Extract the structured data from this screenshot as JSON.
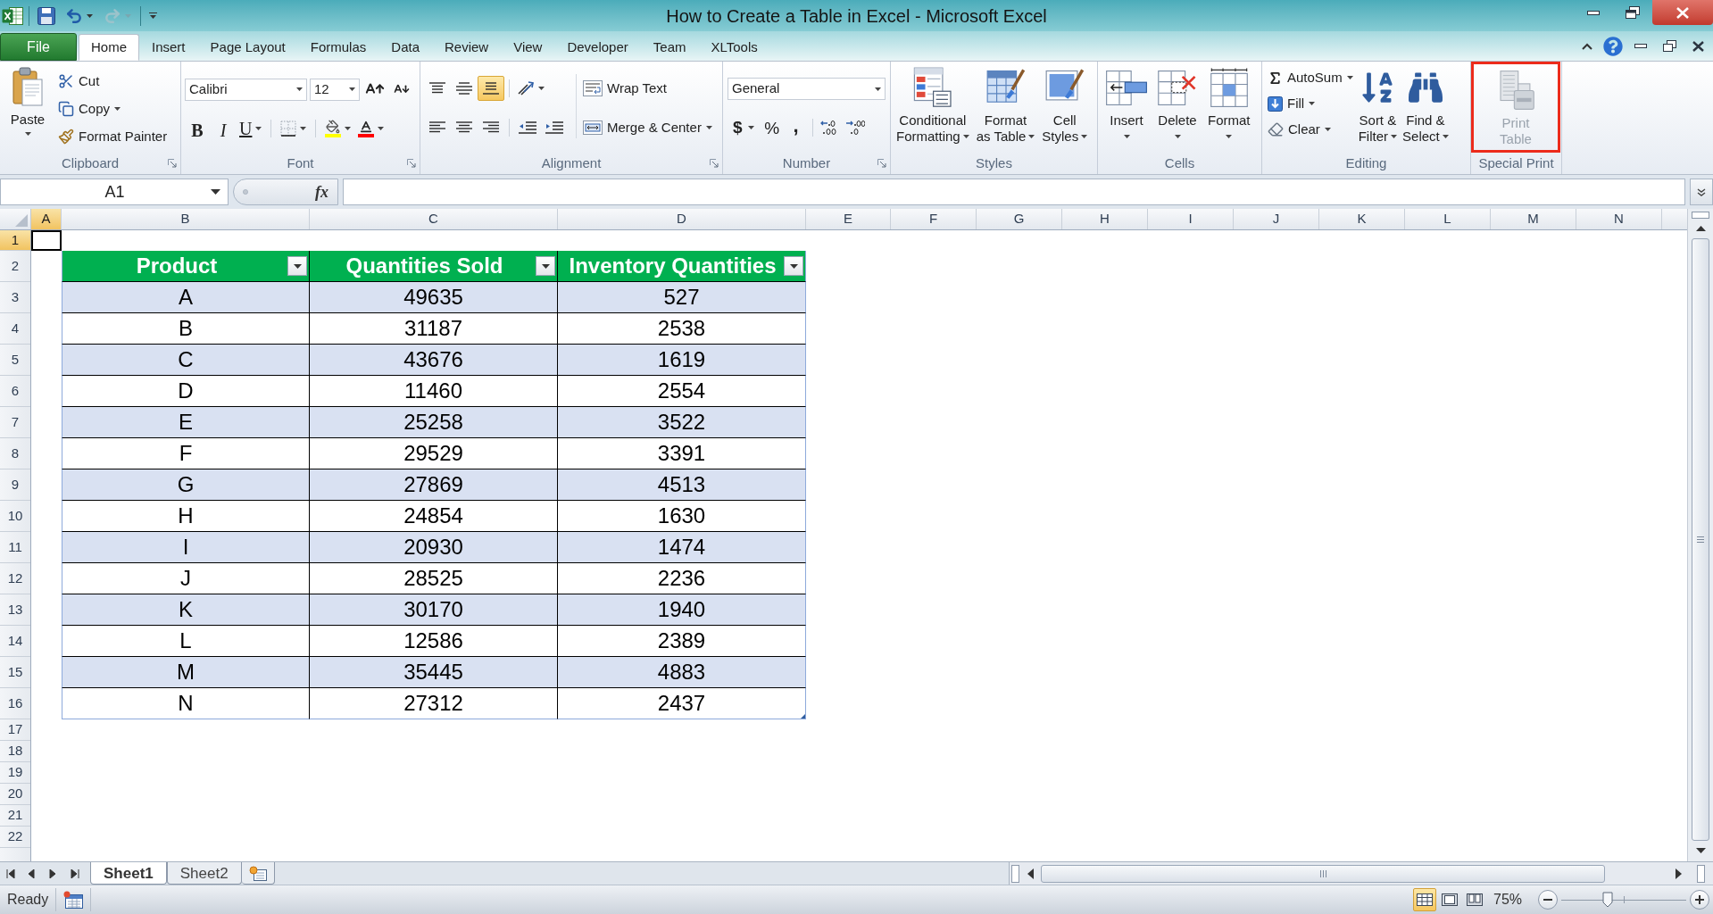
{
  "window": {
    "title": "How to Create a Table in Excel - Microsoft Excel"
  },
  "quick_access": {
    "undo": {
      "disabled": false
    },
    "redo": {
      "disabled": true
    }
  },
  "ribbon_tabs": [
    {
      "label": "File",
      "kind": "file",
      "selected": false
    },
    {
      "label": "Home",
      "kind": "tab",
      "selected": true
    },
    {
      "label": "Insert",
      "kind": "tab",
      "selected": false
    },
    {
      "label": "Page Layout",
      "kind": "tab",
      "selected": false
    },
    {
      "label": "Formulas",
      "kind": "tab",
      "selected": false
    },
    {
      "label": "Data",
      "kind": "tab",
      "selected": false
    },
    {
      "label": "Review",
      "kind": "tab",
      "selected": false
    },
    {
      "label": "View",
      "kind": "tab",
      "selected": false
    },
    {
      "label": "Developer",
      "kind": "tab",
      "selected": false
    },
    {
      "label": "Team",
      "kind": "tab",
      "selected": false
    },
    {
      "label": "XLTools",
      "kind": "tab",
      "selected": false
    }
  ],
  "ribbon": {
    "clipboard": {
      "label": "Clipboard",
      "launcher": true,
      "paste": "Paste",
      "cut": "Cut",
      "copy": "Copy",
      "format_painter": "Format Painter"
    },
    "font": {
      "label": "Font",
      "launcher": true,
      "font_name": "Calibri",
      "font_size": "12",
      "bold": "B",
      "italic": "I",
      "underline": "U"
    },
    "alignment": {
      "label": "Alignment",
      "launcher": true,
      "vertical_align": [
        {
          "selected": false
        },
        {
          "selected": false
        },
        {
          "selected": true
        }
      ],
      "horizontal_align": [
        {
          "selected": false
        },
        {
          "selected": false
        },
        {
          "selected": false
        }
      ],
      "wrap_text": "Wrap Text",
      "merge_center": "Merge & Center"
    },
    "number": {
      "label": "Number",
      "launcher": true,
      "format": "General",
      "currency": "$",
      "percent": "%",
      "comma": ","
    },
    "styles": {
      "label": "Styles",
      "launcher": false,
      "conditional_formatting": [
        "Conditional",
        "Formatting"
      ],
      "format_as_table": [
        "Format",
        "as Table"
      ],
      "cell_styles": [
        "Cell",
        "Styles"
      ]
    },
    "cells": {
      "label": "Cells",
      "launcher": false,
      "insert": "Insert",
      "delete": "Delete",
      "format": "Format"
    },
    "editing": {
      "label": "Editing",
      "launcher": false,
      "autosum": "AutoSum",
      "fill": "Fill",
      "clear": "Clear",
      "sort_filter": [
        "Sort &",
        "Filter"
      ],
      "find_select": [
        "Find &",
        "Select"
      ]
    },
    "special_print": {
      "label": "Special Print",
      "launcher": false,
      "print_table": {
        "label": [
          "Print",
          "Table"
        ],
        "disabled": true,
        "highlighted": true
      }
    }
  },
  "name_box": {
    "value": "A1"
  },
  "formula_bar": {
    "function_button": "fx"
  },
  "column_headers": [
    {
      "label": "A",
      "selected": true
    },
    {
      "label": "B",
      "selected": false
    },
    {
      "label": "C",
      "selected": false
    },
    {
      "label": "D",
      "selected": false
    },
    {
      "label": "E",
      "selected": false
    },
    {
      "label": "F",
      "selected": false
    },
    {
      "label": "G",
      "selected": false
    },
    {
      "label": "H",
      "selected": false
    },
    {
      "label": "I",
      "selected": false
    },
    {
      "label": "J",
      "selected": false
    },
    {
      "label": "K",
      "selected": false
    },
    {
      "label": "L",
      "selected": false
    },
    {
      "label": "M",
      "selected": false
    },
    {
      "label": "N",
      "selected": false
    }
  ],
  "row_headers": [
    {
      "label": "1",
      "selected": true
    },
    {
      "label": "2",
      "selected": false
    },
    {
      "label": "3",
      "selected": false
    },
    {
      "label": "4",
      "selected": false
    },
    {
      "label": "5",
      "selected": false
    },
    {
      "label": "6",
      "selected": false
    },
    {
      "label": "7",
      "selected": false
    },
    {
      "label": "8",
      "selected": false
    },
    {
      "label": "9",
      "selected": false
    },
    {
      "label": "10",
      "selected": false
    },
    {
      "label": "11",
      "selected": false
    },
    {
      "label": "12",
      "selected": false
    },
    {
      "label": "13",
      "selected": false
    },
    {
      "label": "14",
      "selected": false
    },
    {
      "label": "15",
      "selected": false
    },
    {
      "label": "16",
      "selected": false
    },
    {
      "label": "17",
      "selected": false
    },
    {
      "label": "18",
      "selected": false
    },
    {
      "label": "19",
      "selected": false
    },
    {
      "label": "20",
      "selected": false
    },
    {
      "label": "21",
      "selected": false
    },
    {
      "label": "22",
      "selected": false
    }
  ],
  "table": {
    "columns": [
      "Product",
      "Quantities Sold",
      "Inventory Quantities"
    ],
    "rows": [
      [
        "A",
        "49635",
        "527"
      ],
      [
        "B",
        "31187",
        "2538"
      ],
      [
        "C",
        "43676",
        "1619"
      ],
      [
        "D",
        "11460",
        "2554"
      ],
      [
        "E",
        "25258",
        "3522"
      ],
      [
        "F",
        "29529",
        "3391"
      ],
      [
        "G",
        "27869",
        "4513"
      ],
      [
        "H",
        "24854",
        "1630"
      ],
      [
        "I",
        "20930",
        "1474"
      ],
      [
        "J",
        "28525",
        "2236"
      ],
      [
        "K",
        "30170",
        "1940"
      ],
      [
        "L",
        "12586",
        "2389"
      ],
      [
        "M",
        "35445",
        "4883"
      ],
      [
        "N",
        "27312",
        "2437"
      ]
    ]
  },
  "sheet_tabs": [
    {
      "label": "Sheet1",
      "selected": true
    },
    {
      "label": "Sheet2",
      "selected": false
    }
  ],
  "status_bar": {
    "mode": "Ready",
    "views": [
      {
        "selected": true
      },
      {
        "selected": false
      },
      {
        "selected": false
      }
    ],
    "zoom": "75%",
    "zoom_slider": {
      "level": 0.37
    }
  }
}
